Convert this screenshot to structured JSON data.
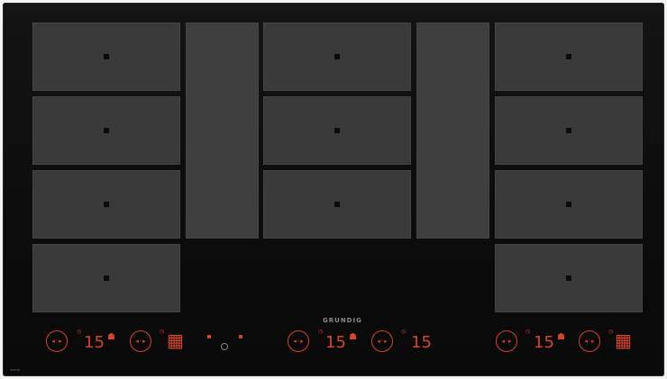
{
  "brand": "GRUNDIG",
  "panels": [
    {
      "id": "left",
      "level1": "15",
      "level2": "",
      "icon1": "slider-ring",
      "icon2": "slider-ring"
    },
    {
      "id": "middle",
      "level1": "15",
      "level2": "15",
      "icon1": "slider-ring",
      "icon2": "slider-ring"
    },
    {
      "id": "right",
      "level1": "15",
      "level2": "",
      "icon1": "slider-ring",
      "icon2": "slider-ring"
    }
  ],
  "colors": {
    "accent": "#d6442a",
    "glass": "#0c0c0c",
    "zone": "#3a3a3a"
  }
}
